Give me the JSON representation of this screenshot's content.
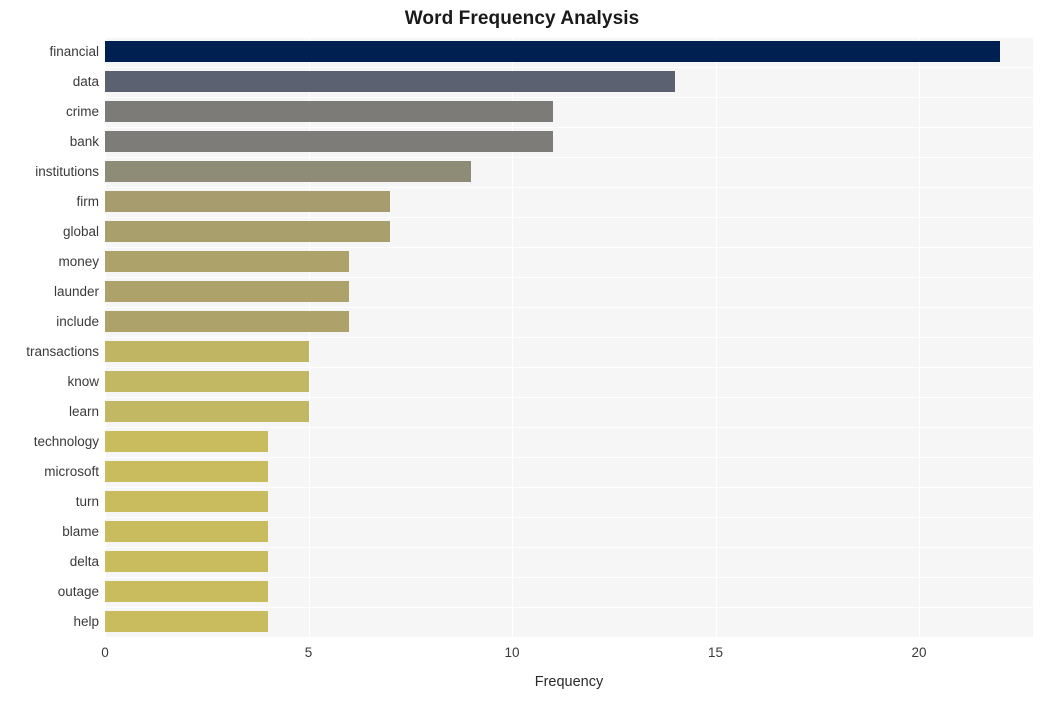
{
  "chart_data": {
    "type": "bar",
    "orientation": "horizontal",
    "title": "Word Frequency Analysis",
    "xlabel": "Frequency",
    "ylabel": "",
    "xlim": [
      0,
      22.8
    ],
    "xticks": [
      0,
      5,
      10,
      15,
      20
    ],
    "xtick_labels": [
      "0",
      "5",
      "10",
      "15",
      "20"
    ],
    "grid": true,
    "legend": "none",
    "background": "#f6f6f7",
    "gridline_color": "#ffffff",
    "categories": [
      "financial",
      "data",
      "crime",
      "bank",
      "institutions",
      "firm",
      "global",
      "money",
      "launder",
      "include",
      "transactions",
      "know",
      "learn",
      "technology",
      "microsoft",
      "turn",
      "blame",
      "delta",
      "outage",
      "help"
    ],
    "values": [
      22,
      14,
      11,
      11,
      9,
      7,
      7,
      6,
      6,
      6,
      5,
      5,
      5,
      4,
      4,
      4,
      4,
      4,
      4,
      4
    ],
    "bar_colors": [
      "#002051",
      "#5c6171",
      "#7c7b78",
      "#7d7c79",
      "#8e8c76",
      "#a69c6d",
      "#a99f6c",
      "#ada36a",
      "#ada36a",
      "#ada36a",
      "#c0b563",
      "#c2b762",
      "#c2b762",
      "#c8bc5e",
      "#c8bc5e",
      "#c8bc5e",
      "#c8bc5e",
      "#c8bc5e",
      "#c8bc5e",
      "#c8bc5e"
    ]
  }
}
